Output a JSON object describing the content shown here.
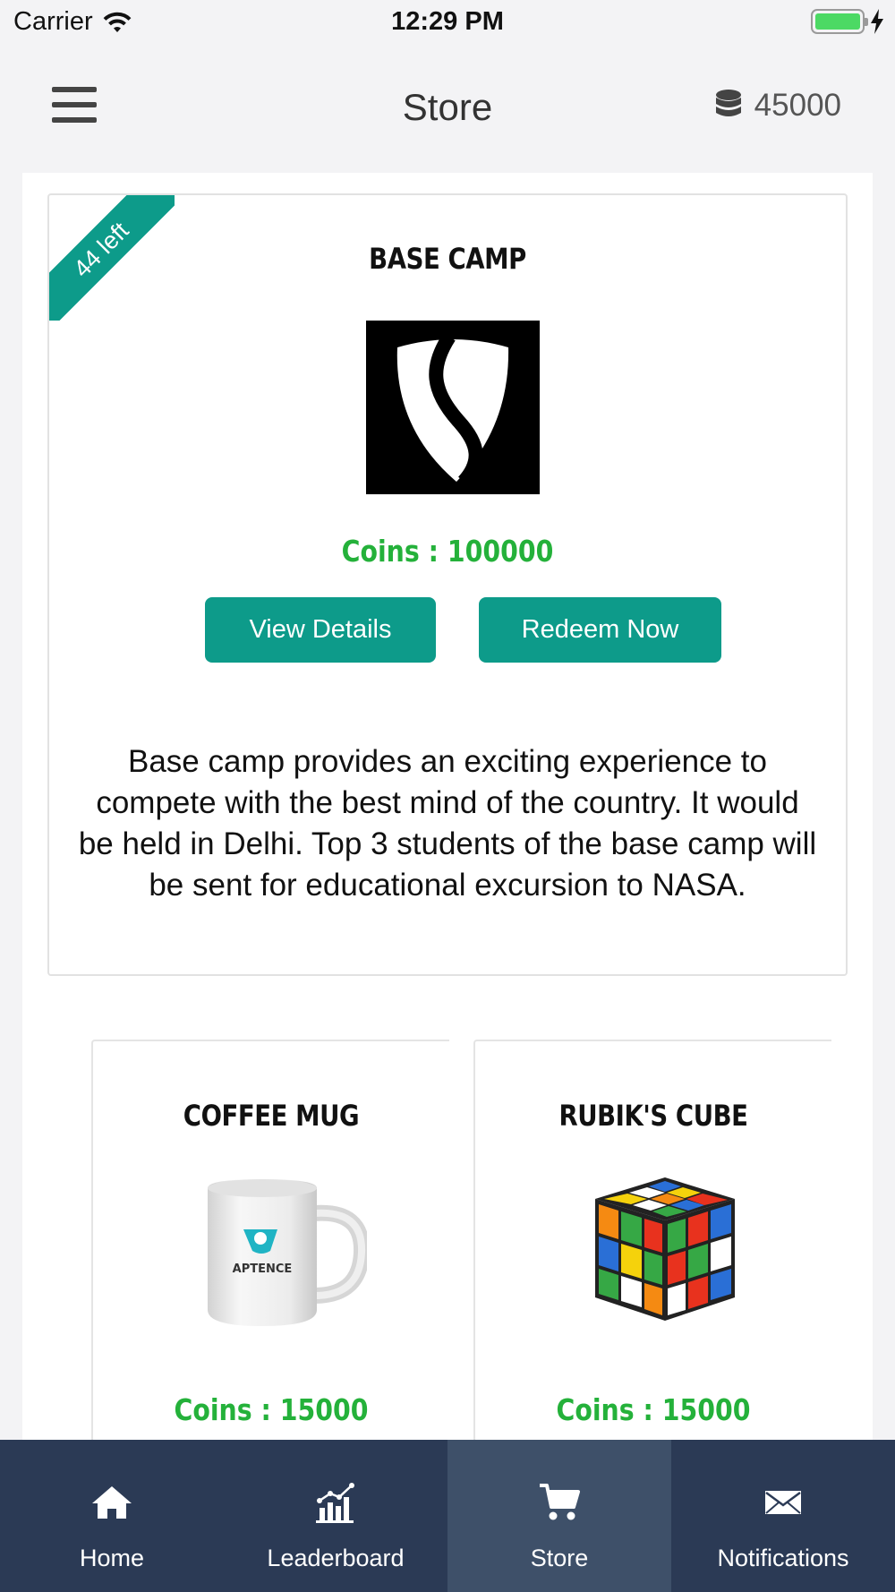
{
  "status_bar": {
    "carrier": "Carrier",
    "time": "12:29 PM",
    "battery_color": "#4cd964"
  },
  "header": {
    "title": "Store",
    "coins": "45000",
    "coin_icon": "coins-stack-icon",
    "menu_icon": "hamburger-menu-icon"
  },
  "featured": {
    "ribbon": "44 left",
    "title": "BASE CAMP",
    "coins": "Coins : 100000",
    "view_details_label": "View Details",
    "redeem_label": "Redeem Now",
    "description": "Base camp provides an exciting experience to compete with the best mind of the country. It would be held in Delhi. Top 3 students of the base camp will be sent for educational excursion to NASA."
  },
  "items": [
    {
      "title": "COFFEE MUG",
      "coins": "Coins : 15000",
      "mug_logo_text": "APTENCE"
    },
    {
      "title": "RUBIK'S CUBE",
      "coins": "Coins : 15000"
    }
  ],
  "tabs": [
    {
      "label": "Home",
      "icon": "home-icon"
    },
    {
      "label": "Leaderboard",
      "icon": "leaderboard-icon"
    },
    {
      "label": "Store",
      "icon": "cart-icon",
      "active": true
    },
    {
      "label": "Notifications",
      "icon": "envelope-icon"
    }
  ],
  "colors": {
    "accent": "#0d9b8a",
    "coins_green": "#24b13a",
    "tab_bar": "#2b3a55",
    "tab_active": "#3e5069"
  }
}
